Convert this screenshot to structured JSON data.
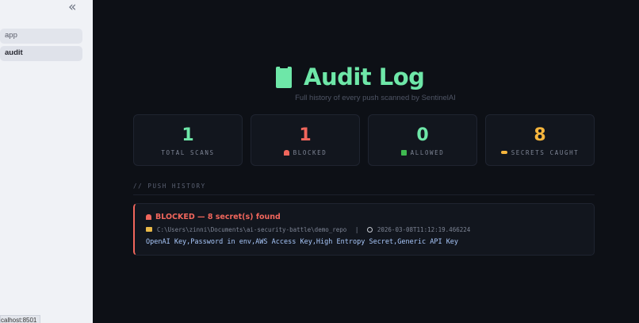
{
  "sidebar": {
    "collapse_label": "«",
    "items": [
      {
        "label": "app"
      },
      {
        "label": "audit"
      }
    ],
    "status_url": "calhost:8501"
  },
  "header": {
    "icon": "clipboard-icon",
    "title": "Audit Log",
    "subtitle": "Full history of every push scanned by SentinelAI"
  },
  "stats": [
    {
      "value": "1",
      "label": "TOTAL SCANS",
      "color": "#6ee7a8"
    },
    {
      "value": "1",
      "label": "BLOCKED",
      "icon": "siren-icon",
      "color": "#f0665c"
    },
    {
      "value": "0",
      "label": "ALLOWED",
      "icon": "check-icon",
      "color": "#6ee7a8"
    },
    {
      "value": "8",
      "label": "SECRETS CAUGHT",
      "icon": "key-icon",
      "color": "#f5b53d"
    }
  ],
  "history": {
    "section_label": "// PUSH HISTORY",
    "entries": [
      {
        "status": "BLOCKED — 8 secret(s) found",
        "path": "C:\\Users\\zinni\\Documents\\ai-security-battle\\demo_repo",
        "separator": "|",
        "timestamp": "2026-03-08T11:12:19.466224",
        "keys": "OpenAI Key,Password in env,AWS Access Key,High Entropy Secret,Generic API Key"
      }
    ]
  },
  "colors": {
    "accent_green": "#6ee7a8",
    "blocked_red": "#f0665c",
    "secrets_yellow": "#f5b53d",
    "background": "#0d1016"
  }
}
